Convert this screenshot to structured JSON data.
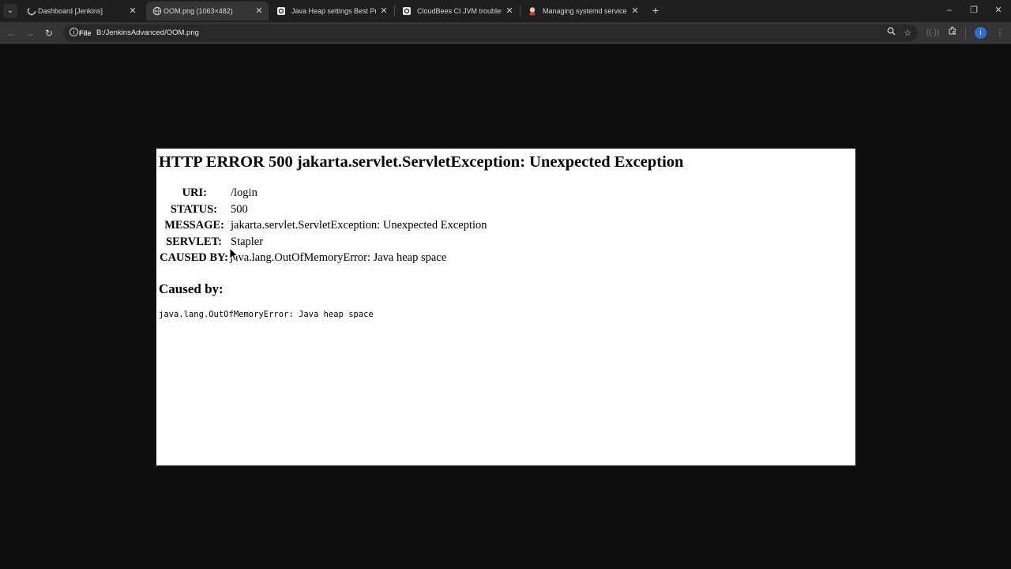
{
  "tabs": [
    {
      "title": "Dashboard [Jenkins]",
      "active": false,
      "icon": "loading-spinner-icon"
    },
    {
      "title": "OOM.png (1063×482)",
      "active": true,
      "icon": "globe-icon"
    },
    {
      "title": "Java Heap settings Best Practic",
      "active": false,
      "icon": "cloudbees-icon"
    },
    {
      "title": "CloudBees CI JVM troubleshoot",
      "active": false,
      "icon": "cloudbees-icon"
    },
    {
      "title": "Managing systemd services",
      "active": false,
      "icon": "jenkins-icon"
    }
  ],
  "toolbar": {
    "scheme_chip": "File",
    "url": "B:/JenkinsAdvanced/OOM.png",
    "profile_initial": "i"
  },
  "page": {
    "title": "HTTP ERROR 500 jakarta.servlet.ServletException: Unexpected Exception",
    "details": [
      {
        "label": "URI:",
        "value": "/login"
      },
      {
        "label": "STATUS:",
        "value": "500"
      },
      {
        "label": "MESSAGE:",
        "value": "jakarta.servlet.ServletException: Unexpected Exception"
      },
      {
        "label": "SERVLET:",
        "value": "Stapler"
      },
      {
        "label": "CAUSED BY:",
        "value": "java.lang.OutOfMemoryError: Java heap space"
      }
    ],
    "caused_by_heading": "Caused by:",
    "stack_trace": "java.lang.OutOfMemoryError: Java heap space"
  },
  "colors": {
    "background": "#0f0f0f",
    "tabstrip": "#1f1f1f",
    "toolbar": "#353535",
    "profile": "#2d6fd6"
  }
}
